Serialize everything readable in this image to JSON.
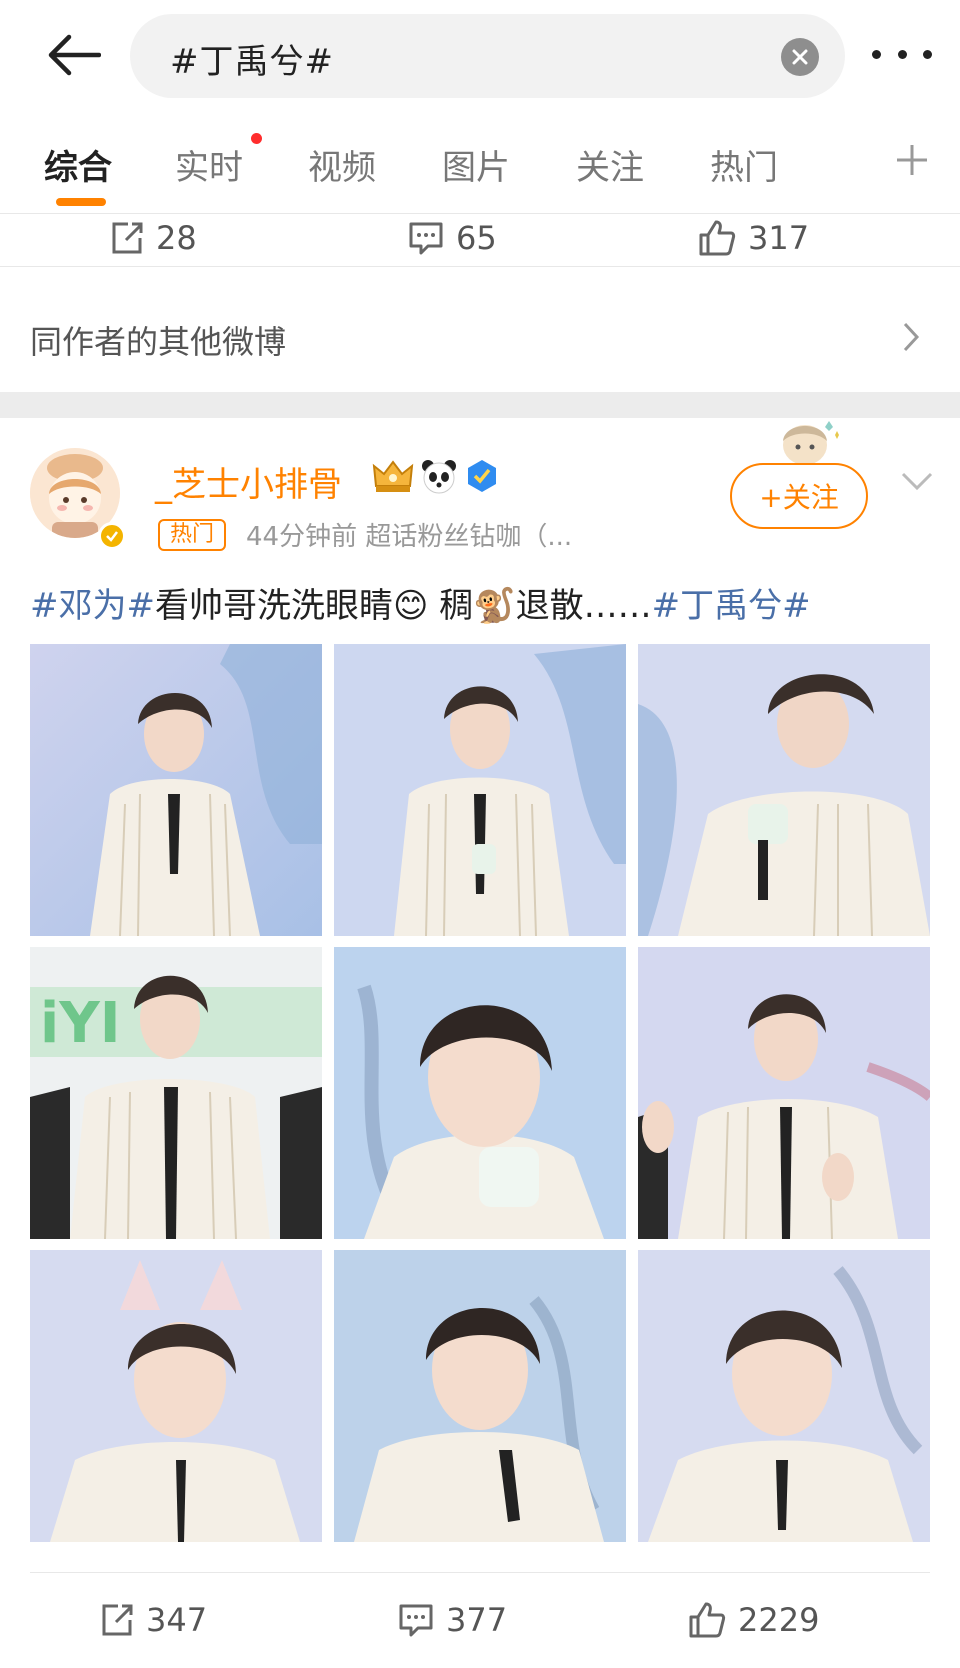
{
  "search": {
    "query": "#丁禹兮#"
  },
  "tabs": [
    {
      "label": "综合",
      "active": true
    },
    {
      "label": "实时",
      "active": false,
      "has_notification_dot": true
    },
    {
      "label": "视频",
      "active": false
    },
    {
      "label": "图片",
      "active": false
    },
    {
      "label": "关注",
      "active": false
    },
    {
      "label": "热门",
      "active": false
    }
  ],
  "prev_post_stats": {
    "reposts": "28",
    "comments": "65",
    "likes": "317"
  },
  "other_posts": {
    "label": "同作者的其他微博"
  },
  "post": {
    "username": "_芝士小排骨",
    "badge": "热门",
    "meta": "44分钟前  超话粉丝钻咖（...",
    "follow_label": "+关注",
    "text": {
      "tag1": "#邓为#",
      "middle": "看帅哥洗洗眼睛😊  稠🐒退散……",
      "tag2": "#丁禹兮#"
    },
    "photo_count": 9,
    "stats": {
      "reposts": "347",
      "comments": "377",
      "likes": "2229"
    }
  },
  "colors": {
    "accent": "#ff8200",
    "tag_blue": "#4a6fa8",
    "notification_red": "#ff2d2d"
  },
  "icons": [
    "back-arrow-icon",
    "clear-icon",
    "more-icon",
    "add-tab-icon",
    "repost-icon",
    "comment-icon",
    "like-icon",
    "chevron-right-icon",
    "chevron-down-icon",
    "crown-icon",
    "panda-icon",
    "verified-icon"
  ]
}
